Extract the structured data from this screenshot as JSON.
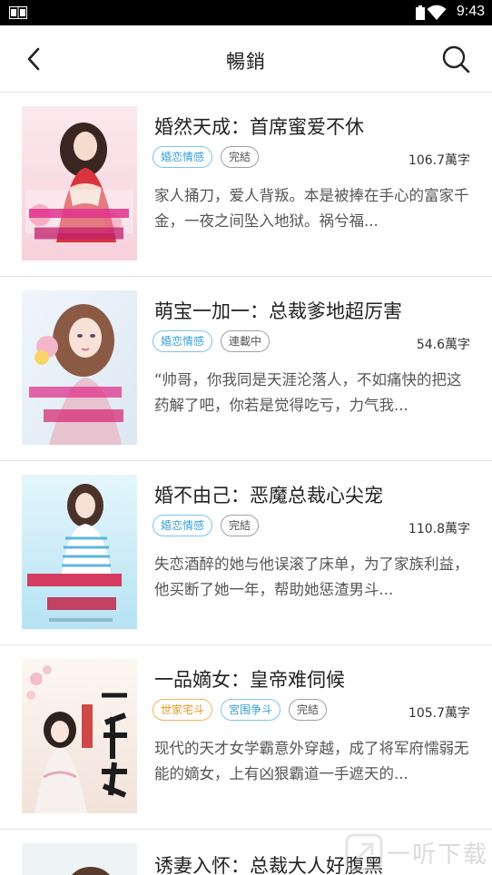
{
  "status_bar": {
    "time": "9:43"
  },
  "header": {
    "title": "暢銷",
    "back_icon": "back-arrow-icon",
    "search_icon": "search-icon"
  },
  "books": [
    {
      "title": "婚然天成：首席蜜爱不休",
      "tags": [
        {
          "label": "婚恋情感",
          "style": "blue"
        },
        {
          "label": "完結",
          "style": "gray"
        }
      ],
      "words": "106.7萬字",
      "desc": "家人捅刀，爱人背叛。本是被捧在手心的富家千金，一夜之间坠入地狱。祸兮福...",
      "cover": {
        "colors": [
          "#fbe4ea",
          "#f6c7d4"
        ],
        "art": "woman-red-dress"
      }
    },
    {
      "title": "萌宝一加一：总裁爹地超厉害",
      "tags": [
        {
          "label": "婚恋情感",
          "style": "blue"
        },
        {
          "label": "連載中",
          "style": "gray"
        }
      ],
      "words": "54.6萬字",
      "desc": "“帅哥，你我同是天涯沦落人，不如痛快的把这药解了吧，你若是觉得吃亏，力气我...",
      "cover": {
        "colors": [
          "#eef4fb",
          "#dbe8f4"
        ],
        "art": "woman-flowers"
      }
    },
    {
      "title": "婚不由己：恶魔总裁心尖宠",
      "tags": [
        {
          "label": "婚恋情感",
          "style": "blue"
        },
        {
          "label": "完結",
          "style": "gray"
        }
      ],
      "words": "110.8萬字",
      "desc": "失恋酒醉的她与他误滚了床单，为了家族利益，他买断了她一年，帮助她惩渣男斗...",
      "cover": {
        "colors": [
          "#d8f1fb",
          "#aee0f3"
        ],
        "art": "woman-striped-shirt"
      }
    },
    {
      "title": "一品嫡女：皇帝难伺候",
      "tags": [
        {
          "label": "世家宅斗",
          "style": "orange"
        },
        {
          "label": "宮围争斗",
          "style": "blue"
        },
        {
          "label": "完結",
          "style": "gray"
        }
      ],
      "words": "105.7萬字",
      "desc": "现代的天才女学霸意外穿越，成了将军府懦弱无能的嫡女，上有凶狠霸道一手遮天的...",
      "cover": {
        "colors": [
          "#fbf4ef",
          "#f3e2da"
        ],
        "art": "woman-ancient"
      }
    }
  ],
  "partial_book": {
    "title": "诱妻入怀：总裁大人好腹黑"
  },
  "watermark": {
    "text": "一听下载"
  }
}
